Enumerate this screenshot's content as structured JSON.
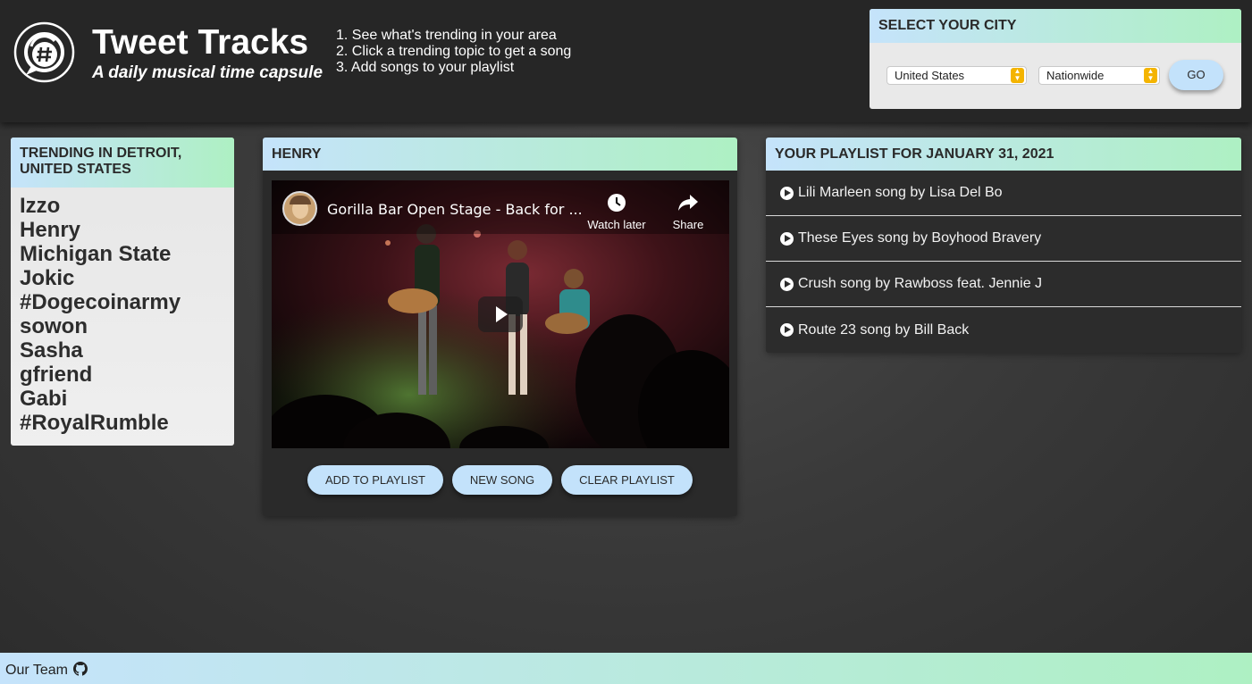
{
  "header": {
    "title": "Tweet Tracks",
    "subtitle": "A daily musical time capsule",
    "steps": [
      "1. See what's trending in your area",
      "2. Click a trending topic to get a song",
      "3. Add songs to your playlist"
    ]
  },
  "city_select": {
    "title": "SELECT YOUR CITY",
    "country": "United States",
    "region": "Nationwide",
    "go_label": "GO"
  },
  "trending": {
    "title": "TRENDING IN DETROIT, UNITED STATES",
    "topics": [
      "Izzo",
      "Henry",
      "Michigan State",
      "Jokic",
      "#Dogecoinarmy",
      "sowon",
      "Sasha",
      "gfriend",
      "Gabi",
      "#RoyalRumble"
    ]
  },
  "player": {
    "title": "HENRY",
    "video_title": "Gorilla Bar Open Stage - Back for ...",
    "watch_later": "Watch later",
    "share": "Share",
    "add_label": "ADD TO PLAYLIST",
    "new_label": "NEW SONG",
    "clear_label": "CLEAR PLAYLIST"
  },
  "playlist": {
    "title": "YOUR PLAYLIST FOR JANUARY 31, 2021",
    "items": [
      "Lili Marleen song by Lisa Del Bo",
      "These Eyes song by Boyhood Bravery",
      "Crush song by Rawboss feat. Jennie J",
      "Route 23 song by Bill Back"
    ]
  },
  "footer": {
    "team_label": "Our Team"
  },
  "colors": {
    "accent_gradient_start": "#c5e3fb",
    "accent_gradient_end": "#aef0c3",
    "button": "#c3e2fb",
    "select_arrow": "#f4b400"
  }
}
